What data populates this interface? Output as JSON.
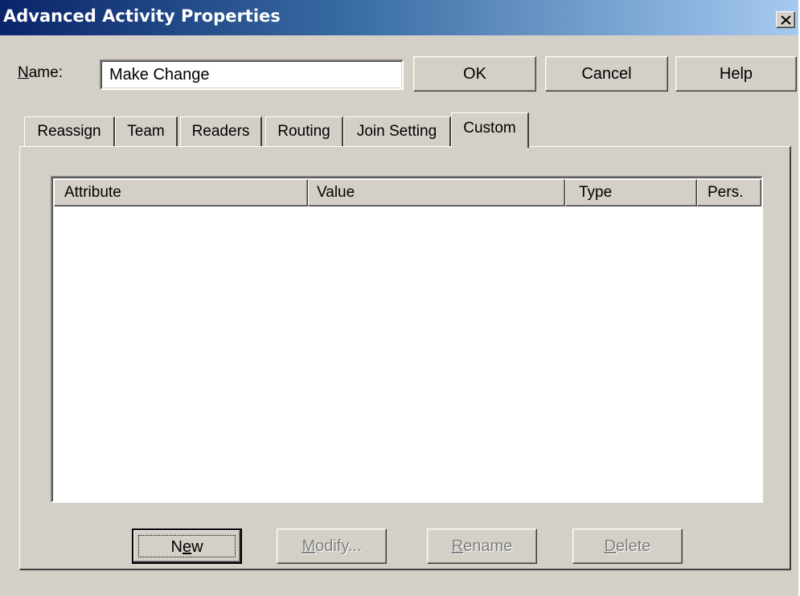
{
  "window": {
    "title": "Advanced Activity Properties",
    "close_glyph": "✕"
  },
  "name_field": {
    "label_mnemonic": "N",
    "label_rest": "ame:",
    "value": "Make Change"
  },
  "dialog_buttons": {
    "ok": "OK",
    "cancel": "Cancel",
    "help": "Help"
  },
  "tabs": [
    {
      "label": "Reassign",
      "active": false
    },
    {
      "label": "Team",
      "active": false
    },
    {
      "label": "Readers",
      "active": false
    },
    {
      "label": "Routing",
      "active": false
    },
    {
      "label": "Join Setting",
      "active": false
    },
    {
      "label": "Custom",
      "active": true
    }
  ],
  "attributes_table": {
    "columns": [
      "Attribute",
      "Value",
      "Type",
      "Pers."
    ],
    "rows": []
  },
  "list_buttons": {
    "new": {
      "pre": "N",
      "mnemonic": "e",
      "post": "w",
      "enabled": true
    },
    "modify": {
      "pre": "",
      "mnemonic": "M",
      "post": "odify...",
      "enabled": false
    },
    "rename": {
      "pre": "",
      "mnemonic": "R",
      "post": "ename",
      "enabled": false
    },
    "delete": {
      "pre": "",
      "mnemonic": "D",
      "post": "elete",
      "enabled": false
    }
  },
  "icons": {
    "close": "close-icon"
  }
}
